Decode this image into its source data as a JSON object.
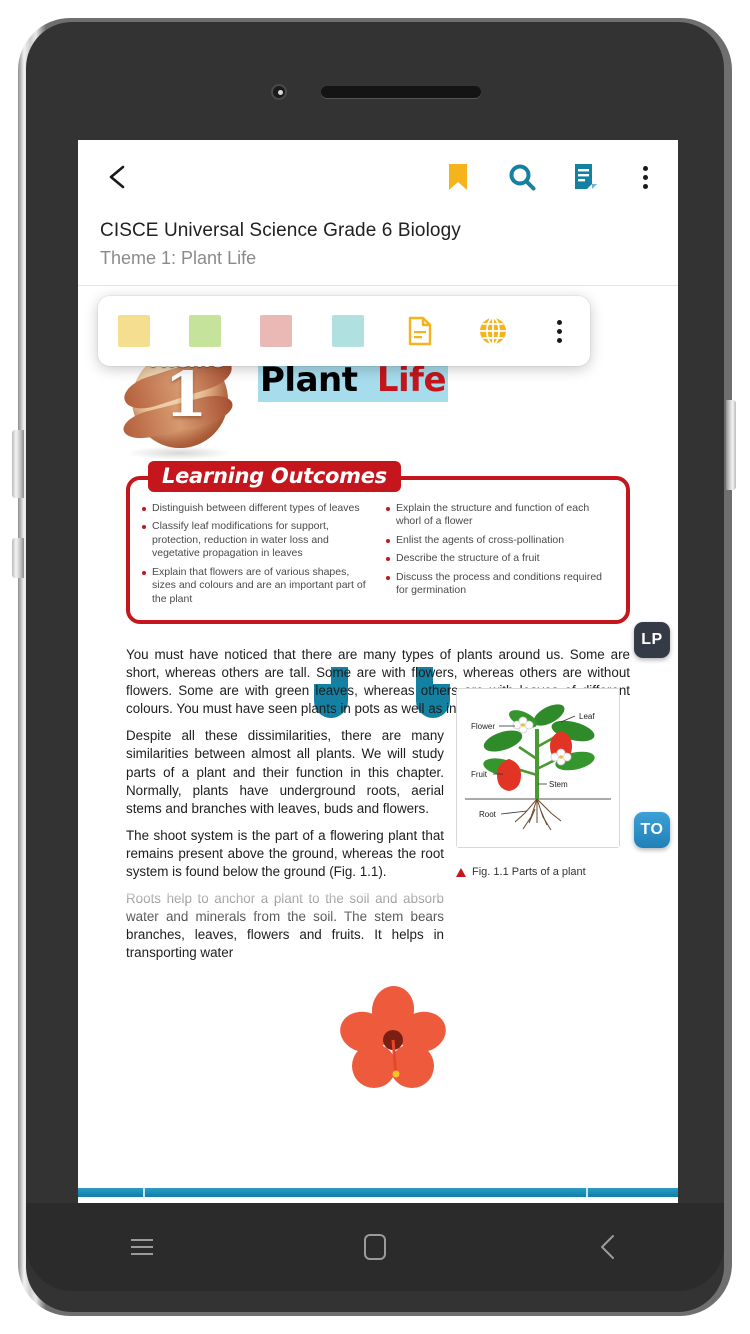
{
  "app": {
    "header": {
      "back_icon": "back-arrow-icon",
      "bookmark_icon": "bookmark-icon",
      "search_icon": "search-icon",
      "notes_icon": "notes-icon",
      "overflow_icon": "kebab-menu-icon",
      "colors": {
        "bookmark": "#f5b31c",
        "search": "#1481a3",
        "notes": "#1481a3"
      }
    },
    "title": {
      "book": "CISCE Universal Science Grade 6 Biology",
      "theme": "Theme 1: Plant Life"
    },
    "highlight_toolbar": {
      "swatches": [
        {
          "name": "highlight-yellow",
          "color": "#f5de8f"
        },
        {
          "name": "highlight-green",
          "color": "#c5e39a"
        },
        {
          "name": "highlight-pink",
          "color": "#eab9b6"
        },
        {
          "name": "highlight-cyan",
          "color": "#b1e0e0"
        }
      ],
      "note_icon": "note-document-icon",
      "web_icon": "globe-icon",
      "overflow_icon": "kebab-menu-icon",
      "icon_color": "#f5b31c"
    },
    "badges": [
      {
        "name": "badge-lp",
        "label": "LP",
        "color": "#343a46"
      },
      {
        "name": "badge-to",
        "label": "TO",
        "color": "#2b8fc6"
      }
    ],
    "nav_bar": {
      "recents_icon": "hamburger-recents-icon",
      "home_icon": "home-square-icon",
      "back_icon": "back-chevron-icon"
    },
    "progress": {
      "color": "#1481a3",
      "percent": 100
    }
  },
  "page": {
    "theme_badge": {
      "word": "Theme",
      "number": "1"
    },
    "chapter_title": {
      "word1": "Plant",
      "word2": "Life",
      "selection_highlight": "#a7dcec"
    },
    "learning_outcomes": {
      "heading": "Learning Outcomes",
      "left": [
        "Distinguish between different types of leaves",
        "Classify leaf modifications for support, protection, reduction in water loss and vegetative propagation in leaves",
        "Explain that flowers are of various shapes, sizes and colours and are an important part of the plant"
      ],
      "right": [
        "Explain the structure and function of each whorl of a flower",
        "Enlist the agents of cross-pollination",
        "Describe the structure of a fruit",
        "Discuss the process and conditions required for germination"
      ]
    },
    "paragraphs": [
      "You must have noticed that there are many types of plants around us. Some are short, whereas others are tall. Some are with flowers, whereas others are without flowers. Some are with green leaves, whereas others are with leaves of different colours. You must have seen plants in pots as well as in fields.",
      "Despite all these dissimilarities, there are many similarities between almost all plants. We will study parts of a plant and their function in this chapter. Normally, plants have underground roots, aerial stems and branches with leaves, buds and flowers.",
      "The shoot system is the part of a flowering plant that remains present above the ground, whereas the root system is found below the ground (Fig. 1.1).",
      "Roots help to anchor a plant to the soil and absorb water and minerals from the soil. The stem bears branches, leaves, flowers and fruits. It helps in transporting water"
    ],
    "figure": {
      "caption": "Fig. 1.1 Parts of a plant",
      "labels": {
        "flower": "Flower",
        "leaf": "Leaf",
        "fruit": "Fruit",
        "stem": "Stem",
        "root": "Root"
      }
    }
  }
}
